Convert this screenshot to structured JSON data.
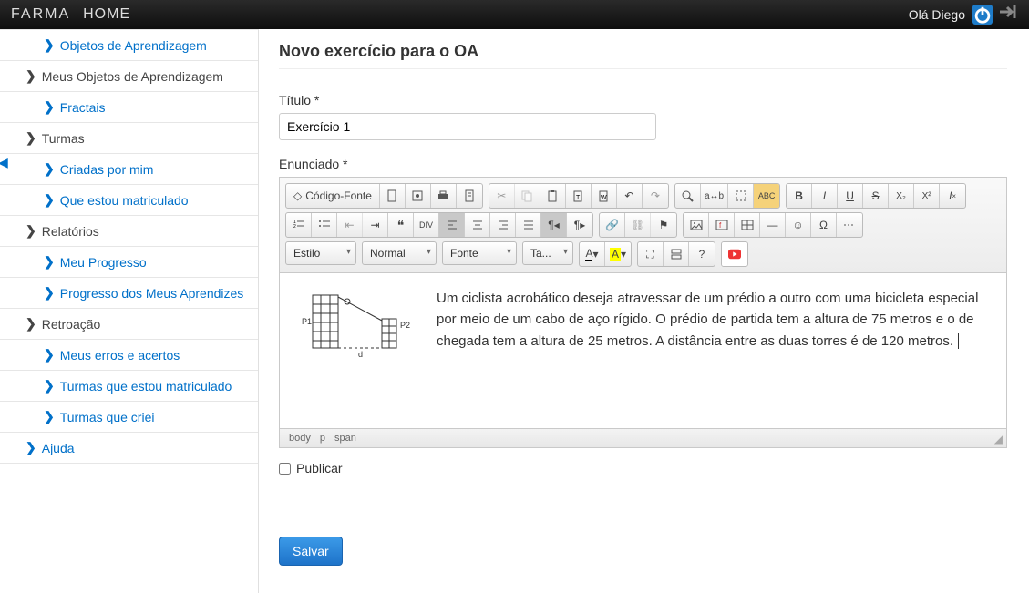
{
  "topbar": {
    "brand": "FARMA",
    "home": "HOME",
    "greeting": "Olá Diego",
    "power_icon": "⏻",
    "logout_icon": "➜]"
  },
  "sidebar": {
    "items": [
      {
        "label": "Objetos de Aprendizagem",
        "child": true,
        "dark": false
      },
      {
        "label": "Meus Objetos de Aprendizagem",
        "child": false,
        "dark": true
      },
      {
        "label": "Fractais",
        "child": true,
        "dark": false
      },
      {
        "label": "Turmas",
        "child": false,
        "dark": true
      },
      {
        "label": "Criadas por mim",
        "child": true,
        "dark": false
      },
      {
        "label": "Que estou matriculado",
        "child": true,
        "dark": false
      },
      {
        "label": "Relatórios",
        "child": false,
        "dark": true
      },
      {
        "label": "Meu Progresso",
        "child": true,
        "dark": false
      },
      {
        "label": "Progresso dos Meus Aprendizes",
        "child": true,
        "dark": false
      },
      {
        "label": "Retroação",
        "child": false,
        "dark": true
      },
      {
        "label": "Meus erros e acertos",
        "child": true,
        "dark": false
      },
      {
        "label": "Turmas que estou matriculado",
        "child": true,
        "dark": false
      },
      {
        "label": "Turmas que criei",
        "child": true,
        "dark": false
      },
      {
        "label": "Ajuda",
        "child": false,
        "dark": false
      }
    ]
  },
  "page": {
    "title": "Novo exercício para o OA",
    "titulo_label": "Título *",
    "titulo_value": "Exercício 1",
    "enunciado_label": "Enunciado *",
    "publicar_label": "Publicar",
    "salvar_label": "Salvar"
  },
  "toolbar": {
    "source": "Código-Fonte",
    "style": "Estilo",
    "format": "Normal",
    "font": "Fonte",
    "size": "Ta...",
    "textcolor": "A",
    "bgcolor": "A"
  },
  "editor": {
    "body_text": "Um ciclista acrobático deseja atravessar de um prédio a outro com uma bicicleta especial por meio de um cabo de aço rígido. O prédio de partida tem a altura de 75 metros e o de chegada tem a altura de 25 metros. A distância entre as duas torres é de 120 metros.",
    "path": [
      "body",
      "p",
      "span"
    ],
    "illustration": {
      "p1": "P1",
      "p2": "P2",
      "d": "d"
    }
  }
}
